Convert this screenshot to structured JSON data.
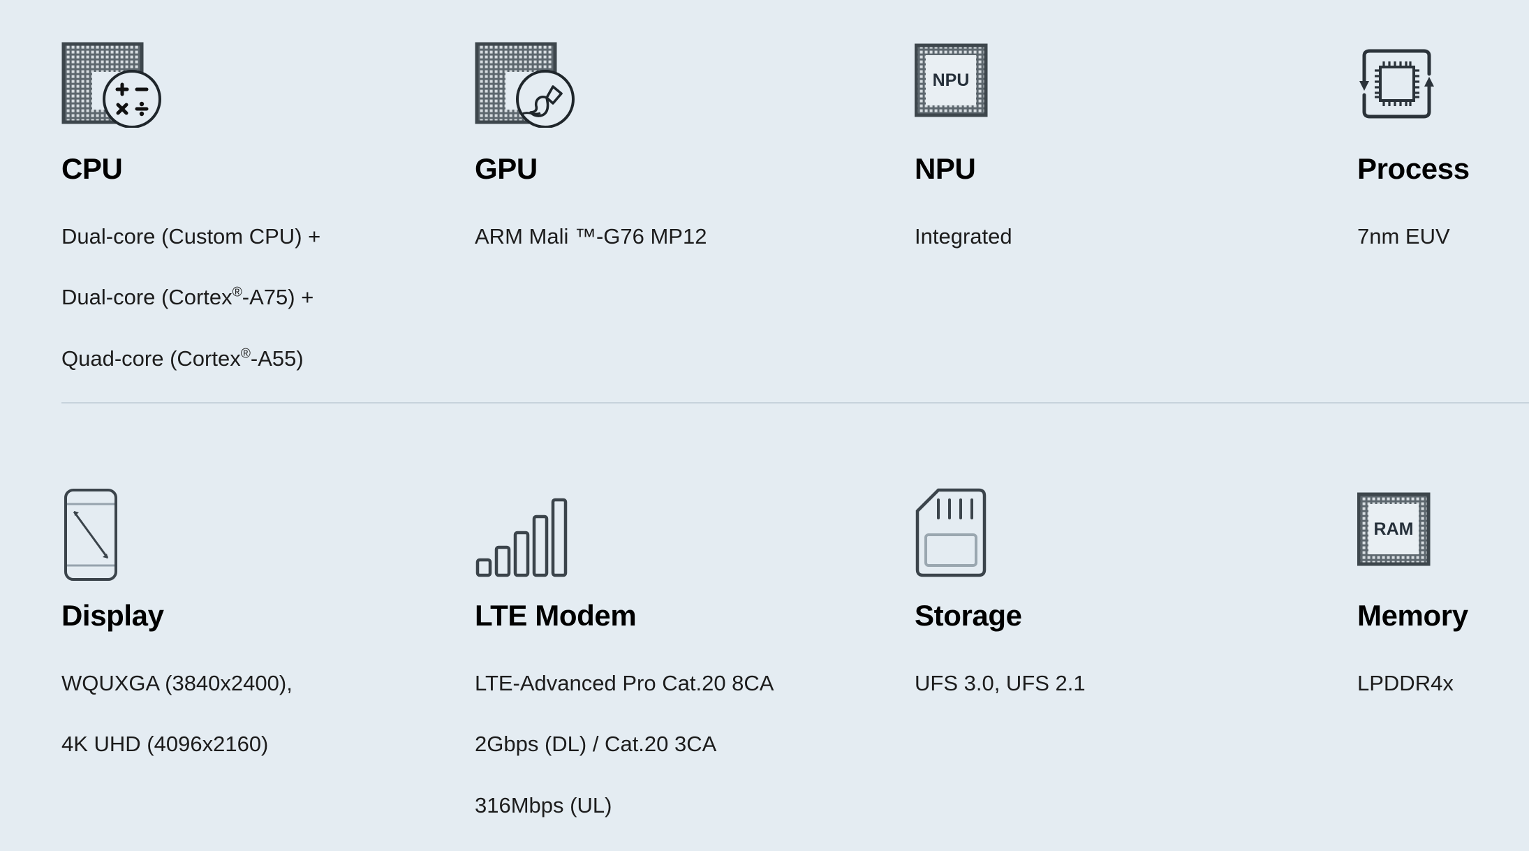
{
  "theme": {
    "background": "#e4ecf2",
    "title_color": "#000000",
    "text_color": "#1c1c1c",
    "divider_color": "#c7d3dc",
    "icon_color": "#333d44"
  },
  "rows": [
    {
      "cards": [
        {
          "icon": "cpu-chip-calculator-icon",
          "title": "CPU",
          "desc_lines": [
            {
              "pre": "Dual-core (Custom CPU) +",
              "sup": "",
              "post": ""
            },
            {
              "pre": "Dual-core (Cortex",
              "sup": "®",
              "post": "-A75) +"
            },
            {
              "pre": "Quad-core (Cortex",
              "sup": "®",
              "post": "-A55)"
            }
          ]
        },
        {
          "icon": "gpu-chip-brush-icon",
          "title": "GPU",
          "desc_lines": [
            {
              "pre": "ARM Mali ™-G76 MP12",
              "sup": "",
              "post": ""
            }
          ]
        },
        {
          "icon": "npu-chip-icon",
          "icon_label": "NPU",
          "title": "NPU",
          "desc_lines": [
            {
              "pre": "Integrated",
              "sup": "",
              "post": ""
            }
          ]
        },
        {
          "icon": "process-cycle-chip-icon",
          "title": "Process",
          "desc_lines": [
            {
              "pre": "7nm EUV",
              "sup": "",
              "post": ""
            }
          ]
        }
      ]
    },
    {
      "cards": [
        {
          "icon": "display-phone-diagonal-icon",
          "title": "Display",
          "desc_lines": [
            {
              "pre": "WQUXGA (3840x2400),",
              "sup": "",
              "post": ""
            },
            {
              "pre": "4K UHD (4096x2160)",
              "sup": "",
              "post": ""
            }
          ]
        },
        {
          "icon": "lte-signal-bars-icon",
          "title": "LTE Modem",
          "desc_lines": [
            {
              "pre": "LTE-Advanced Pro Cat.20 8CA",
              "sup": "",
              "post": ""
            },
            {
              "pre": "2Gbps (DL) / Cat.20 3CA",
              "sup": "",
              "post": ""
            },
            {
              "pre": "316Mbps (UL)",
              "sup": "",
              "post": ""
            }
          ]
        },
        {
          "icon": "storage-sd-card-icon",
          "title": "Storage",
          "desc_lines": [
            {
              "pre": "UFS 3.0, UFS 2.1",
              "sup": "",
              "post": ""
            }
          ]
        },
        {
          "icon": "memory-ram-chip-icon",
          "icon_label": "RAM",
          "title": "Memory",
          "desc_lines": [
            {
              "pre": "LPDDR4x",
              "sup": "",
              "post": ""
            }
          ]
        }
      ]
    }
  ]
}
